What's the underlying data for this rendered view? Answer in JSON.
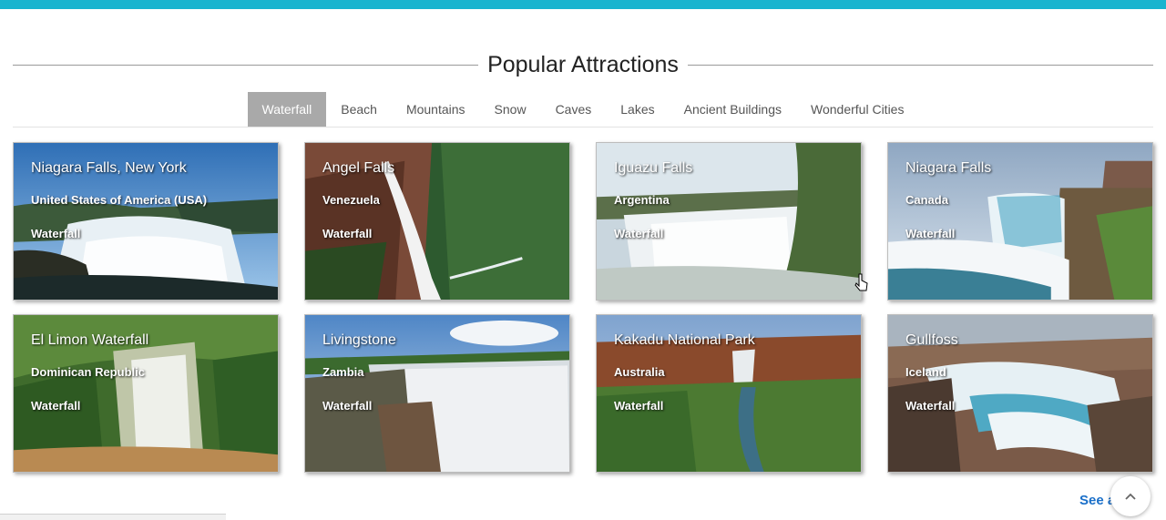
{
  "section": {
    "title": "Popular Attractions"
  },
  "tabs": [
    {
      "label": "Waterfall",
      "active": true
    },
    {
      "label": "Beach"
    },
    {
      "label": "Mountains"
    },
    {
      "label": "Snow"
    },
    {
      "label": "Caves"
    },
    {
      "label": "Lakes"
    },
    {
      "label": "Ancient Buildings"
    },
    {
      "label": "Wonderful Cities"
    }
  ],
  "cards": [
    {
      "name": "Niagara Falls, New York",
      "country": "United States of America (USA)",
      "category": "Waterfall"
    },
    {
      "name": "Angel Falls",
      "country": "Venezuela",
      "category": "Waterfall"
    },
    {
      "name": "Iguazu Falls",
      "country": "Argentina",
      "category": "Waterfall"
    },
    {
      "name": "Niagara Falls",
      "country": "Canada",
      "category": "Waterfall"
    },
    {
      "name": "El Limon Waterfall",
      "country": "Dominican Republic",
      "category": "Waterfall"
    },
    {
      "name": "Livingstone",
      "country": "Zambia",
      "category": "Waterfall"
    },
    {
      "name": "Kakadu National Park",
      "country": "Australia",
      "category": "Waterfall"
    },
    {
      "name": "Gullfoss",
      "country": "Iceland",
      "category": "Waterfall"
    }
  ],
  "see_all": {
    "label": "See all"
  },
  "icons": {
    "scroll_top": "chevron-up-icon",
    "cursor": "mouse-pointer-icon"
  },
  "colors": {
    "top_bar": "#19b4cf",
    "active_tab": "#a9a9a9",
    "link": "#1a6fc9"
  }
}
